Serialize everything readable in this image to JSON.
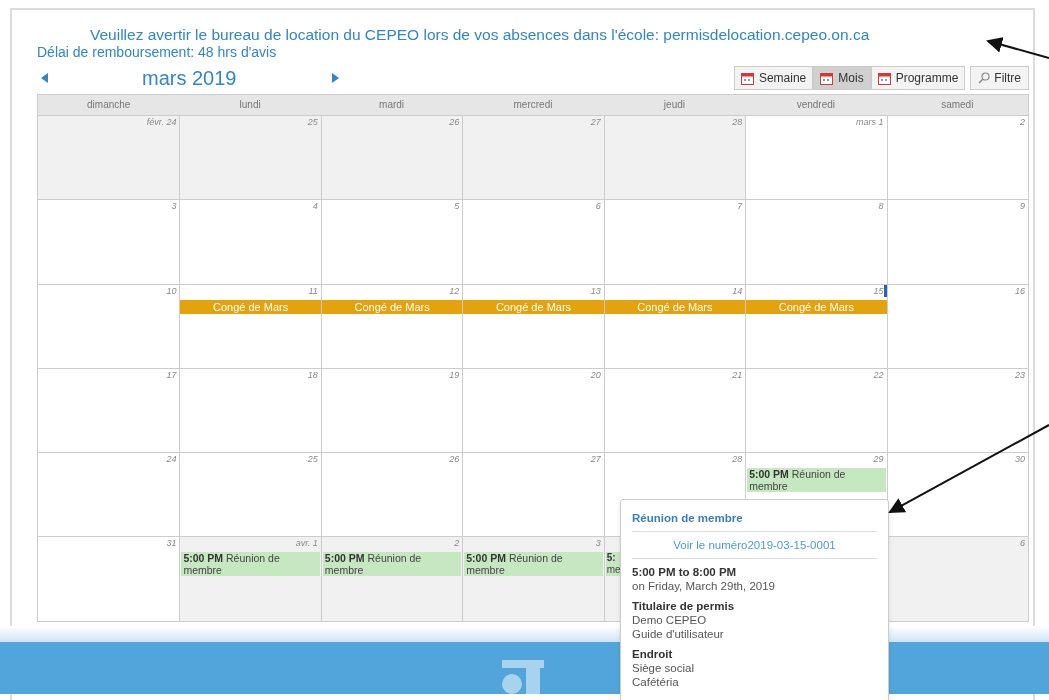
{
  "notice": "Veuillez avertir le bureau de location du CEPEO lors de vos absences dans l'école: permisdelocation.cepeo.on.ca",
  "delay": "Délai de remboursement: 48 hrs d'avis",
  "month_title": "mars 2019",
  "views": [
    {
      "label": "Semaine",
      "selected": false
    },
    {
      "label": "Mois",
      "selected": true
    },
    {
      "label": "Programme",
      "selected": false
    }
  ],
  "filter_button": "Filtre",
  "weekdays": [
    "dimanche",
    "lundi",
    "mardi",
    "mercredi",
    "jeudi",
    "vendredi",
    "samedi"
  ],
  "weeks": [
    [
      {
        "day": "févr. 24",
        "other_month": true
      },
      {
        "day": "25",
        "other_month": true
      },
      {
        "day": "26",
        "other_month": true
      },
      {
        "day": "27",
        "other_month": true
      },
      {
        "day": "28",
        "other_month": true
      },
      {
        "day": "mars 1",
        "other_month": false
      },
      {
        "day": "2",
        "other_month": false
      }
    ],
    [
      {
        "day": "3",
        "other_month": false
      },
      {
        "day": "4",
        "other_month": false
      },
      {
        "day": "5",
        "other_month": false
      },
      {
        "day": "6",
        "other_month": false
      },
      {
        "day": "7",
        "other_month": false
      },
      {
        "day": "8",
        "other_month": false
      },
      {
        "day": "9",
        "other_month": false
      }
    ],
    [
      {
        "day": "10",
        "other_month": false
      },
      {
        "day": "11",
        "other_month": false,
        "events": [
          {
            "kind": "allday",
            "title": "Congé de Mars",
            "color": "#e4a20c"
          }
        ]
      },
      {
        "day": "12",
        "other_month": false,
        "events": [
          {
            "kind": "allday",
            "title": "Congé de Mars",
            "color": "#e4a20c"
          }
        ]
      },
      {
        "day": "13",
        "other_month": false,
        "events": [
          {
            "kind": "allday",
            "title": "Congé de Mars",
            "color": "#e4a20c"
          }
        ]
      },
      {
        "day": "14",
        "other_month": false,
        "events": [
          {
            "kind": "allday",
            "title": "Congé de Mars",
            "color": "#e4a20c"
          }
        ]
      },
      {
        "day": "15",
        "other_month": false,
        "events": [
          {
            "kind": "allday",
            "title": "Congé de Mars",
            "color": "#e4a20c"
          }
        ]
      },
      {
        "day": "16",
        "other_month": false
      }
    ],
    [
      {
        "day": "17",
        "other_month": false
      },
      {
        "day": "18",
        "other_month": false
      },
      {
        "day": "19",
        "other_month": false
      },
      {
        "day": "20",
        "other_month": false
      },
      {
        "day": "21",
        "other_month": false
      },
      {
        "day": "22",
        "other_month": false
      },
      {
        "day": "23",
        "other_month": false
      }
    ],
    [
      {
        "day": "24",
        "other_month": false
      },
      {
        "day": "25",
        "other_month": false
      },
      {
        "day": "26",
        "other_month": false
      },
      {
        "day": "27",
        "other_month": false
      },
      {
        "day": "28",
        "other_month": false
      },
      {
        "day": "29",
        "other_month": false,
        "events": [
          {
            "kind": "timed",
            "time": "5:00 PM",
            "title": "Réunion de membre",
            "color": "#c5e8c0"
          }
        ]
      },
      {
        "day": "30",
        "other_month": false
      }
    ],
    [
      {
        "day": "31",
        "other_month": false
      },
      {
        "day": "avr. 1",
        "other_month": true,
        "events": [
          {
            "kind": "timed",
            "time": "5:00 PM",
            "title": "Réunion de membre",
            "color": "#c5e8c0"
          }
        ]
      },
      {
        "day": "2",
        "other_month": true,
        "events": [
          {
            "kind": "timed",
            "time": "5:00 PM",
            "title": "Réunion de membre",
            "color": "#c5e8c0"
          }
        ]
      },
      {
        "day": "3",
        "other_month": true,
        "events": [
          {
            "kind": "timed",
            "time": "5:00 PM",
            "title": "Réunion de membre",
            "color": "#c5e8c0"
          }
        ]
      },
      {
        "other_month": true,
        "events": [
          {
            "kind": "clipped",
            "time": "5:",
            "title": "me",
            "color": "#c5e8c0"
          }
        ]
      },
      {
        "day": "6",
        "other_month": true
      }
    ]
  ],
  "popup": {
    "title": "Réunion de membre",
    "link": "Voir le numéro2019-03-15-0001",
    "time": "5:00 PM to 8:00 PM",
    "date": "on Friday, March 29th, 2019",
    "sections": [
      {
        "heading": "Titulaire de permis",
        "lines": [
          "Demo CEPEO",
          "Guide d'utilisateur"
        ]
      },
      {
        "heading": "Endroit",
        "lines": [
          "Siège social",
          "Cafétéria"
        ]
      }
    ]
  }
}
